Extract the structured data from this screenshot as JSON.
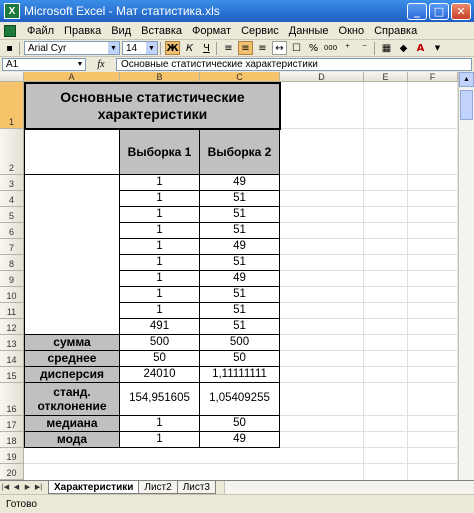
{
  "window": {
    "app_icon": "X",
    "title": "Microsoft Excel - Мат статистика.xls",
    "minimize": "_",
    "maximize": "□",
    "close": "✕"
  },
  "menu": [
    "Файл",
    "Правка",
    "Вид",
    "Вставка",
    "Формат",
    "Сервис",
    "Данные",
    "Окно",
    "Справка"
  ],
  "toolbar": {
    "font_name": "Arial Cyr",
    "font_size": "14",
    "bold": "Ж",
    "italic": "К",
    "underline": "Ч",
    "percent": "%",
    "thousands": "000"
  },
  "formula_bar": {
    "name_box": "A1",
    "fx": "fx",
    "formula": "Основные статистические характеристики"
  },
  "columns": [
    "A",
    "B",
    "C",
    "D",
    "E",
    "F"
  ],
  "rows": [
    "1",
    "2",
    "3",
    "4",
    "5",
    "6",
    "7",
    "8",
    "9",
    "10",
    "11",
    "12",
    "13",
    "14",
    "15",
    "16",
    "17",
    "18",
    "19",
    "20"
  ],
  "table": {
    "title": "Основные статистические характеристики",
    "header_b": "Выборка 1",
    "header_c": "Выборка 2",
    "data": [
      [
        "1",
        "49"
      ],
      [
        "1",
        "51"
      ],
      [
        "1",
        "51"
      ],
      [
        "1",
        "51"
      ],
      [
        "1",
        "49"
      ],
      [
        "1",
        "51"
      ],
      [
        "1",
        "49"
      ],
      [
        "1",
        "51"
      ],
      [
        "1",
        "51"
      ],
      [
        "491",
        "51"
      ]
    ],
    "stats": [
      {
        "label": "сумма",
        "b": "500",
        "c": "500"
      },
      {
        "label": "среднее",
        "b": "50",
        "c": "50"
      },
      {
        "label": "дисперсия",
        "b": "24010",
        "c": "1,11111111"
      },
      {
        "label": "станд. отклонение",
        "b": "154,951605",
        "c": "1,05409255"
      },
      {
        "label": "медиана",
        "b": "1",
        "c": "50"
      },
      {
        "label": "мода",
        "b": "1",
        "c": "49"
      }
    ]
  },
  "sheet_tabs": [
    "Характеристики",
    "Лист2",
    "Лист3"
  ],
  "active_tab": "Характеристики",
  "status": "Готово",
  "colors": {
    "title_bar": "#1f5fc4",
    "header_fill": "#c0c0c0",
    "selected_header": "#f5c36a"
  }
}
